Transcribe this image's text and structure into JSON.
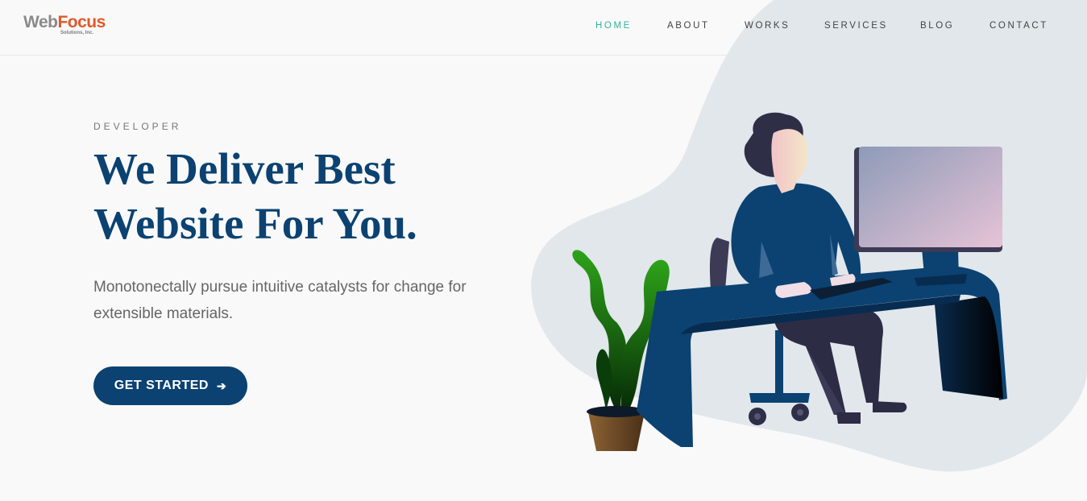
{
  "brand": {
    "logo_word_1": "Web",
    "logo_word_2": "Focus",
    "logo_sub": "Solutions, Inc."
  },
  "nav": {
    "items": [
      {
        "label": "HOME",
        "active": true
      },
      {
        "label": "ABOUT",
        "active": false
      },
      {
        "label": "WORKS",
        "active": false
      },
      {
        "label": "SERVICES",
        "active": false
      },
      {
        "label": "BLOG",
        "active": false
      },
      {
        "label": "CONTACT",
        "active": false
      }
    ]
  },
  "hero": {
    "eyebrow": "DEVELOPER",
    "headline_line_1": "We Deliver Best",
    "headline_line_2": "Website For You.",
    "description": "Monotonectally pursue intuitive catalysts for change for extensible materials.",
    "cta_label": "GET STARTED",
    "cta_icon": "arrow-right-icon"
  },
  "colors": {
    "accent": "#2fb59a",
    "brand_navy": "#0b4271",
    "logo_gray": "#8a8a8a",
    "logo_orange": "#e2572a",
    "blob": "#e1e7eb"
  }
}
